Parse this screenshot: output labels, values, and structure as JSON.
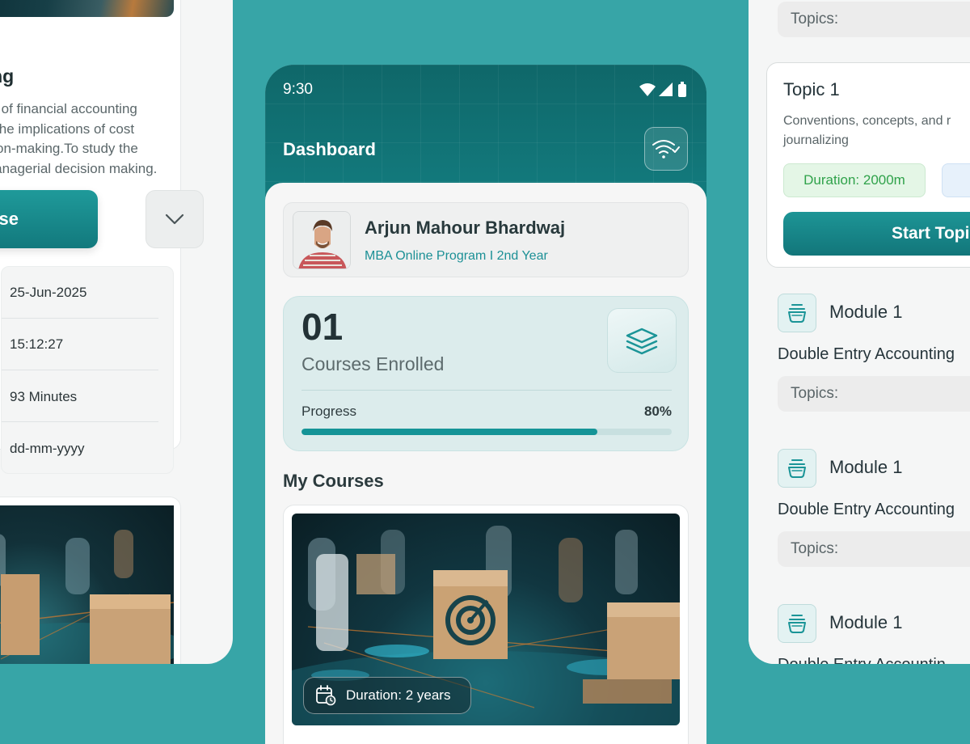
{
  "left": {
    "title": "nting",
    "description": "ntals of financial accounting lore the implications of cost ecision-making.To study the in managerial decision making.",
    "desc_lines": [
      "ntals of financial accounting",
      "lore the implications of cost",
      "ecision-making.To study the",
      "in managerial decision making."
    ],
    "course_button": "ourse",
    "info_rows": [
      "25-Jun-2025",
      "15:12:27",
      "93 Minutes",
      "dd-mm-yyyy"
    ]
  },
  "phone": {
    "status_time": "9:30",
    "dashboard_title": "Dashboard",
    "profile": {
      "name": "Arjun Mahour Bhardwaj",
      "subtitle": "MBA Online Program I 2nd Year"
    },
    "stats": {
      "count": "01",
      "label": "Courses Enrolled",
      "progress_label": "Progress",
      "progress_value": "80%",
      "progress_fraction": 0.8
    },
    "my_courses_title": "My Courses",
    "course": {
      "duration": "Duration: 2 years"
    }
  },
  "right": {
    "top_topics": "Topics:",
    "topic": {
      "title": "Topic 1",
      "desc_line1": "Conventions, concepts, and r",
      "desc_line2": "journalizing",
      "duration_badge": "Duration: 2000m",
      "start_button": "Start Topic"
    },
    "modules": [
      {
        "title": "Module 1",
        "subtitle": "Double Entry Accounting",
        "topics": "Topics:"
      },
      {
        "title": "Module 1",
        "subtitle": "Double Entry Accounting",
        "topics": "Topics:"
      },
      {
        "title": "Module 1",
        "subtitle": "Double Entry Accountin"
      }
    ]
  },
  "colors": {
    "background": "#37a5a7",
    "brand": "#12797d",
    "accent": "#159497",
    "success": "#2fa24a"
  }
}
